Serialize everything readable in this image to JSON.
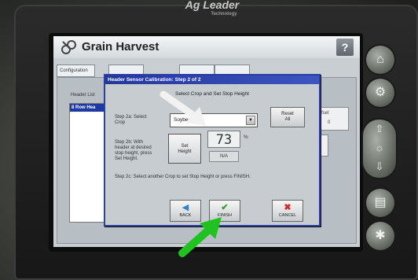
{
  "device": {
    "brand": "Ag Leader",
    "brand_sub": "Technology"
  },
  "app": {
    "title": "Grain Harvest",
    "help_label": "?"
  },
  "background": {
    "tabs": [
      "Configuration",
      "",
      "",
      "",
      ""
    ],
    "header_list_label": "Header List",
    "selected_header": "8 Row Hea",
    "right_box_label": "fset",
    "right_box_value": "0"
  },
  "dialog": {
    "title": "Header Sensor Calibration:  Step 2 of 2",
    "heading": "Select Crop and Set Stop Height",
    "step2a": [
      "Step 2a: Select",
      "Crop"
    ],
    "crop_value": "Soybeans",
    "reset_label": [
      "Reset",
      "All"
    ],
    "step2b": [
      "Step 2b: With",
      "header at desired",
      "stop height, press",
      "Set Height."
    ],
    "set_height_label": [
      "Set",
      "Height"
    ],
    "height_value": "73",
    "height_unit": "%",
    "na_label": "N/A",
    "step2c": "Step 2c: Select another Crop to set Stop Height or press FINISH.",
    "back_label": "BACK",
    "finish_label": "FINISH",
    "cancel_label": "CANCEL"
  },
  "icons": {
    "back": "back-arrow-icon",
    "finish": "checkmark-icon",
    "cancel": "x-icon",
    "dropdown": "chevron-down-icon"
  },
  "colors": {
    "dialog_border": "#2a3fa0",
    "title_blue": "#22379b",
    "finish_green": "#2d9b2d",
    "cancel_red": "#d22b2b",
    "annotation_green": "#1fc21f"
  }
}
